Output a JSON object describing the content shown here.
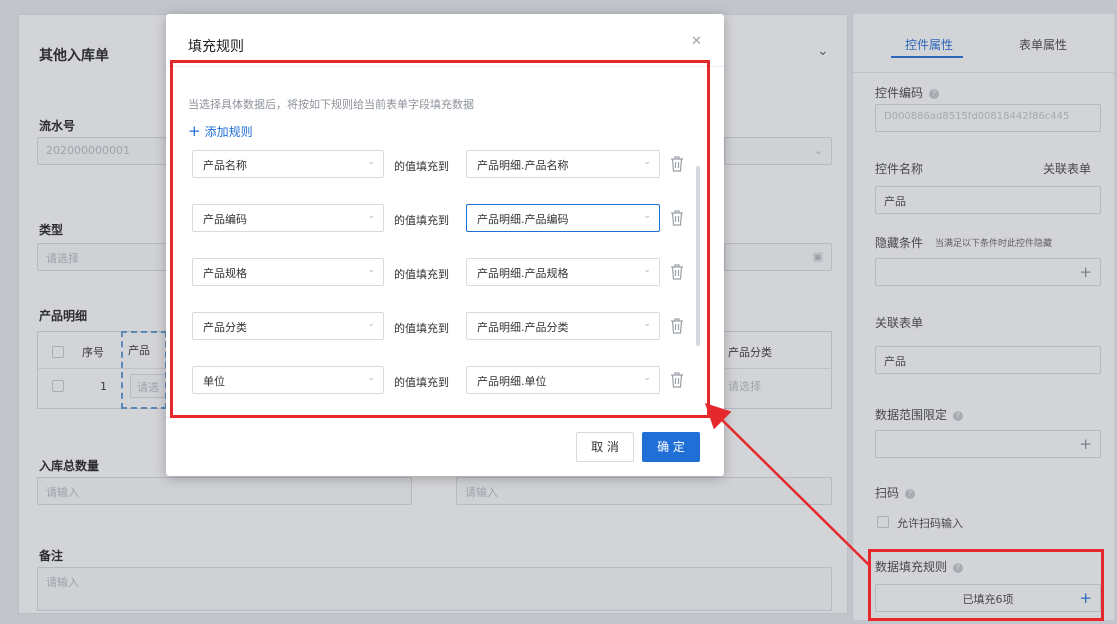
{
  "form": {
    "title": "其他入库单",
    "serial_label": "流水号",
    "serial_value": "202000000001",
    "type_label": "类型",
    "type_placeholder": "请选择",
    "detail_label": "产品明细",
    "detail_columns": [
      "序号",
      "产品",
      "产品分类"
    ],
    "detail_rows": [
      {
        "index": "1",
        "product_placeholder": "请选",
        "category_placeholder": "请选择"
      }
    ],
    "total_label": "入库总数量",
    "total_placeholder": "请输入",
    "total_right_placeholder": "请输入",
    "remark_label": "备注",
    "remark_placeholder": "请输入"
  },
  "panel": {
    "tabs": [
      {
        "label": "控件属性",
        "active": true
      },
      {
        "label": "表单属性",
        "active": false
      }
    ],
    "code_label": "控件编码",
    "code_value": "D000886ad8515fd00818442f86c445",
    "name_label": "控件名称",
    "name_link": "关联表单",
    "name_value": "产品",
    "hide_label": "隐藏条件",
    "hide_hint": "当满足以下条件时此控件隐藏",
    "relation_label": "关联表单",
    "relation_value": "产品",
    "range_label": "数据范围限定",
    "scan_label": "扫码",
    "scan_checkbox": "允许扫码输入",
    "fill_label": "数据填充规则",
    "fill_value": "已填充6项"
  },
  "modal": {
    "title": "填充规则",
    "hint": "当选择具体数据后，将按如下规则给当前表单字段填充数据",
    "add_rule": "添加规则",
    "fill_to": "的值填充到",
    "rules": [
      {
        "source": "产品名称",
        "target": "产品明细.产品名称",
        "focused": false
      },
      {
        "source": "产品编码",
        "target": "产品明细.产品编码",
        "focused": true
      },
      {
        "source": "产品规格",
        "target": "产品明细.产品规格",
        "focused": false
      },
      {
        "source": "产品分类",
        "target": "产品明细.产品分类",
        "focused": false
      },
      {
        "source": "单位",
        "target": "产品明细.单位",
        "focused": false
      }
    ],
    "cancel": "取 消",
    "ok": "确 定"
  },
  "colors": {
    "accent": "#1f6fd6",
    "callout": "#e4282b"
  }
}
